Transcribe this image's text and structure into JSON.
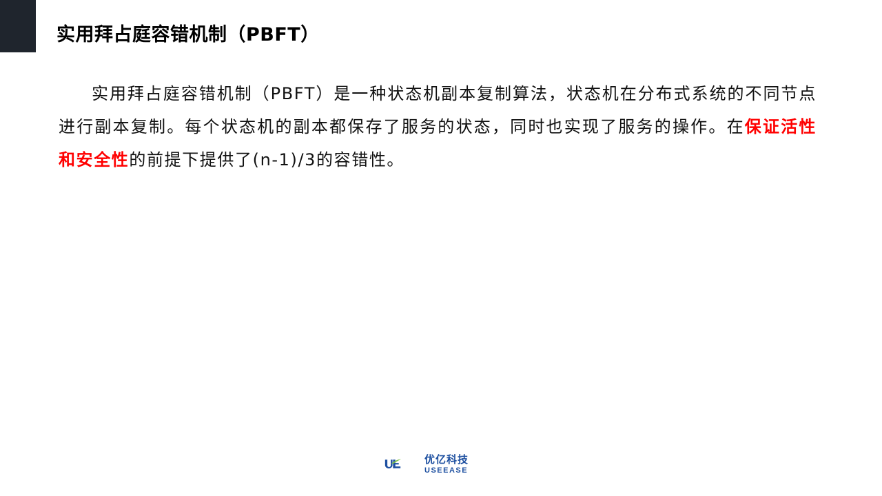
{
  "header": {
    "title": "实用拜占庭容错机制（PBFT）"
  },
  "body": {
    "text_before": "实用拜占庭容错机制（PBFT）是一种状态机副本复制算法，状态机在分布式系统的不同节点进行副本复制。每个状态机的副本都保存了服务的状态，同时也实现了服务的操作。在",
    "highlight": "保证活性和安全性",
    "text_after": "的前提下提供了(n-1)/3的容错性。",
    "highlight_color": "#ff0000"
  },
  "footer": {
    "logo_cn": "优亿科技",
    "logo_en": "USEEASE",
    "brand_color": "#1d4fa0"
  }
}
